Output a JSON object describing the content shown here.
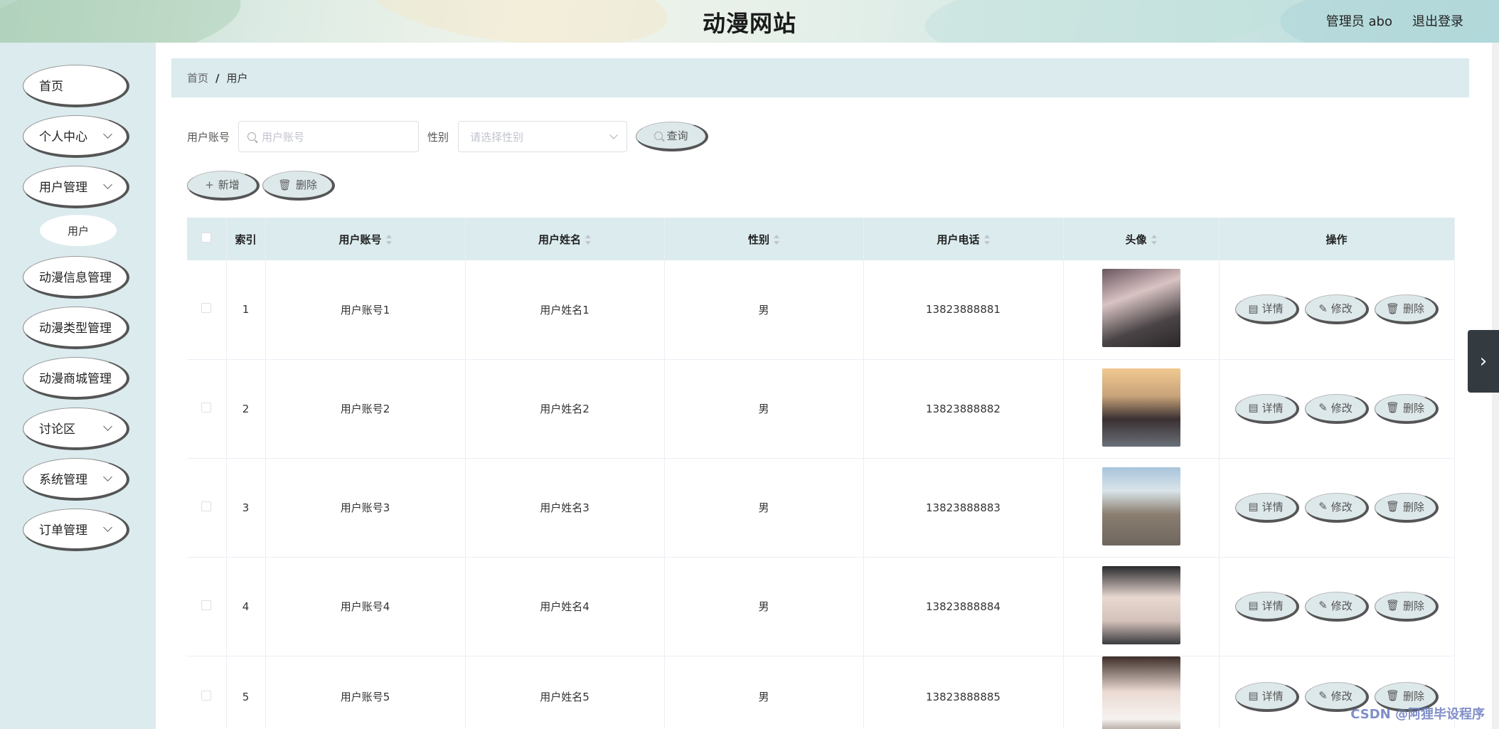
{
  "header": {
    "title": "动漫网站",
    "admin_label": "管理员 abo",
    "logout_label": "退出登录"
  },
  "sidebar": {
    "items": [
      {
        "label": "首页",
        "has_submenu": false
      },
      {
        "label": "个人中心",
        "has_submenu": true
      },
      {
        "label": "用户管理",
        "has_submenu": true
      },
      {
        "label": "动漫信息管理",
        "has_submenu": false
      },
      {
        "label": "动漫类型管理",
        "has_submenu": false
      },
      {
        "label": "动漫商城管理",
        "has_submenu": false
      },
      {
        "label": "讨论区",
        "has_submenu": true
      },
      {
        "label": "系统管理",
        "has_submenu": true
      },
      {
        "label": "订单管理",
        "has_submenu": true
      }
    ],
    "submenu_user": "用户"
  },
  "breadcrumb": {
    "home": "首页",
    "separator": "/",
    "current": "用户"
  },
  "search": {
    "account_label": "用户账号",
    "account_placeholder": "用户账号",
    "gender_label": "性别",
    "gender_placeholder": "请选择性别",
    "query_button": "查询"
  },
  "actions": {
    "add_button": "新增",
    "delete_button": "删除"
  },
  "table": {
    "columns": [
      "索引",
      "用户账号",
      "用户姓名",
      "性别",
      "用户电话",
      "头像",
      "操作"
    ],
    "rows": [
      {
        "index": "1",
        "account": "用户账号1",
        "name": "用户姓名1",
        "gender": "男",
        "phone": "13823888881"
      },
      {
        "index": "2",
        "account": "用户账号2",
        "name": "用户姓名2",
        "gender": "男",
        "phone": "13823888882"
      },
      {
        "index": "3",
        "account": "用户账号3",
        "name": "用户姓名3",
        "gender": "男",
        "phone": "13823888883"
      },
      {
        "index": "4",
        "account": "用户账号4",
        "name": "用户姓名4",
        "gender": "男",
        "phone": "13823888884"
      },
      {
        "index": "5",
        "account": "用户账号5",
        "name": "用户姓名5",
        "gender": "男",
        "phone": "13823888885"
      }
    ],
    "row_actions": {
      "detail": "详情",
      "edit": "修改",
      "delete": "删除"
    }
  },
  "watermark": "CSDN @阿狸毕设程序",
  "colors": {
    "panel_bg": "#dbebee",
    "button_bg": "#dde8ea",
    "button_shadow": "#555555"
  }
}
